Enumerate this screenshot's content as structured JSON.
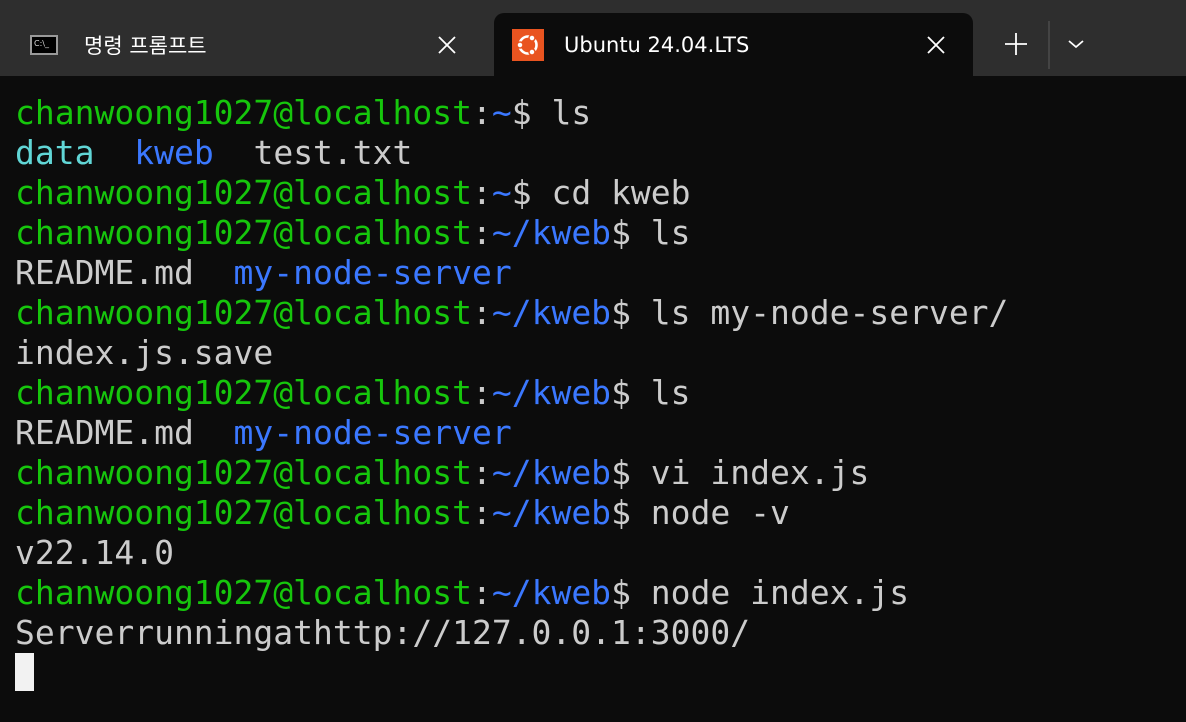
{
  "tabs": [
    {
      "label": "명령 프롬프트",
      "icon": "command-prompt-icon",
      "active": false
    },
    {
      "label": "Ubuntu 24.04.LTS",
      "icon": "ubuntu-icon",
      "active": true
    }
  ],
  "colors": {
    "green": "#16c60c",
    "blue": "#3b78ff",
    "cyan": "#61d6d6",
    "white": "#cccccc",
    "tabbar": "#2e2e2e",
    "terminal_bg": "#0c0c0c",
    "ubuntu": "#e95420"
  },
  "terminal": {
    "lines": [
      [
        [
          "chanwoong1027@localhost",
          "green"
        ],
        [
          ":",
          "white"
        ],
        [
          "~",
          "blue"
        ],
        [
          "$ ls",
          "white"
        ]
      ],
      [
        [
          "data",
          "cyan"
        ],
        [
          "  ",
          "white"
        ],
        [
          "kweb",
          "blue"
        ],
        [
          "  test.txt",
          "white"
        ]
      ],
      [
        [
          "chanwoong1027@localhost",
          "green"
        ],
        [
          ":",
          "white"
        ],
        [
          "~",
          "blue"
        ],
        [
          "$ cd kweb",
          "white"
        ]
      ],
      [
        [
          "chanwoong1027@localhost",
          "green"
        ],
        [
          ":",
          "white"
        ],
        [
          "~/kweb",
          "blue"
        ],
        [
          "$ ls",
          "white"
        ]
      ],
      [
        [
          "README.md  ",
          "white"
        ],
        [
          "my-node-server",
          "blue"
        ]
      ],
      [
        [
          "chanwoong1027@localhost",
          "green"
        ],
        [
          ":",
          "white"
        ],
        [
          "~/kweb",
          "blue"
        ],
        [
          "$ ls my-node-server/",
          "white"
        ]
      ],
      [
        [
          "index.js.save",
          "white"
        ]
      ],
      [
        [
          "chanwoong1027@localhost",
          "green"
        ],
        [
          ":",
          "white"
        ],
        [
          "~/kweb",
          "blue"
        ],
        [
          "$ ls",
          "white"
        ]
      ],
      [
        [
          "README.md  ",
          "white"
        ],
        [
          "my-node-server",
          "blue"
        ]
      ],
      [
        [
          "chanwoong1027@localhost",
          "green"
        ],
        [
          ":",
          "white"
        ],
        [
          "~/kweb",
          "blue"
        ],
        [
          "$ vi index.js",
          "white"
        ]
      ],
      [
        [
          "chanwoong1027@localhost",
          "green"
        ],
        [
          ":",
          "white"
        ],
        [
          "~/kweb",
          "blue"
        ],
        [
          "$ node -v",
          "white"
        ]
      ],
      [
        [
          "v22.14.0",
          "white"
        ]
      ],
      [
        [
          "chanwoong1027@localhost",
          "green"
        ],
        [
          ":",
          "white"
        ],
        [
          "~/kweb",
          "blue"
        ],
        [
          "$ node index.js",
          "white"
        ]
      ],
      [
        [
          "Serverrunningathttp://127.0.0.1:3000/",
          "white"
        ]
      ]
    ]
  }
}
